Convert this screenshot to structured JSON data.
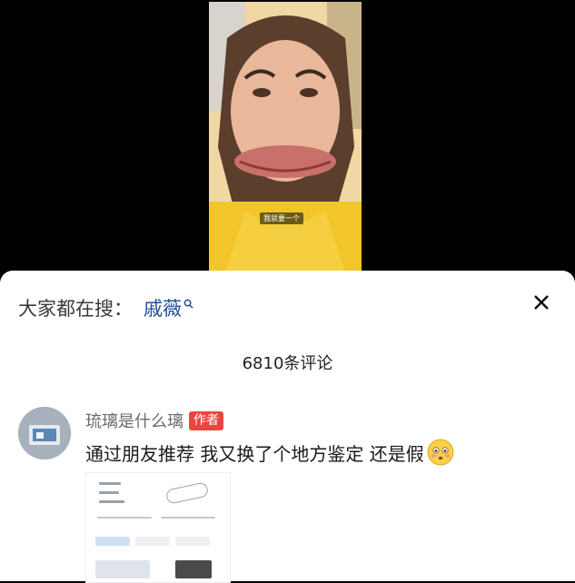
{
  "video": {
    "caption": "我就要一个"
  },
  "search_suggestion": {
    "prefix": "大家都在搜：",
    "term": "戚薇"
  },
  "comments_panel": {
    "count_label": "6810条评论"
  },
  "comment": {
    "username": "琉璃是什么璃",
    "badge": "作者",
    "text": "通过朋友推荐 我又换了个地方鉴定  还是假"
  },
  "icons": {
    "search": "search-icon",
    "close": "close-icon",
    "emoji": "blushing-emoji-icon"
  },
  "colors": {
    "search_term": "#1f4d91",
    "badge": "#e8463f",
    "username": "#6b6b6b"
  }
}
